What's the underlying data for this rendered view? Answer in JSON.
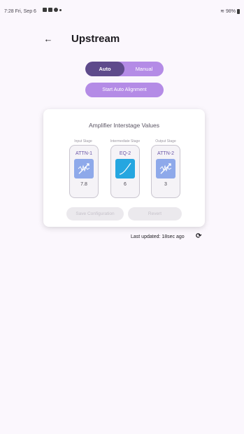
{
  "status_bar": {
    "time": "7:28",
    "date": "Fri, Sep 6",
    "battery": "98%"
  },
  "header": {
    "title": "Upstream"
  },
  "mode": {
    "options": [
      "Auto",
      "Manual"
    ],
    "selected": "Auto"
  },
  "actions": {
    "start_alignment": "Start Auto Alignment"
  },
  "card": {
    "title": "Amplifier Interstage Values",
    "stages": [
      {
        "label": "Input Stage",
        "name": "ATTN-1",
        "value": "7.8",
        "icon": "attenuator-icon"
      },
      {
        "label": "Intermediate Stage",
        "name": "EQ-2",
        "value": "6",
        "icon": "equalizer-curve-icon"
      },
      {
        "label": "Output Stage",
        "name": "ATTN-2",
        "value": "3",
        "icon": "attenuator-icon"
      }
    ],
    "save_label": "Save Configuration",
    "revert_label": "Revert"
  },
  "footer": {
    "last_updated": "Last updated: 18sec ago"
  },
  "colors": {
    "accent": "#b48be6",
    "selected": "#5e4b8b",
    "eq_icon": "#25a6e0",
    "atten_icon": "#8ea9ea"
  }
}
